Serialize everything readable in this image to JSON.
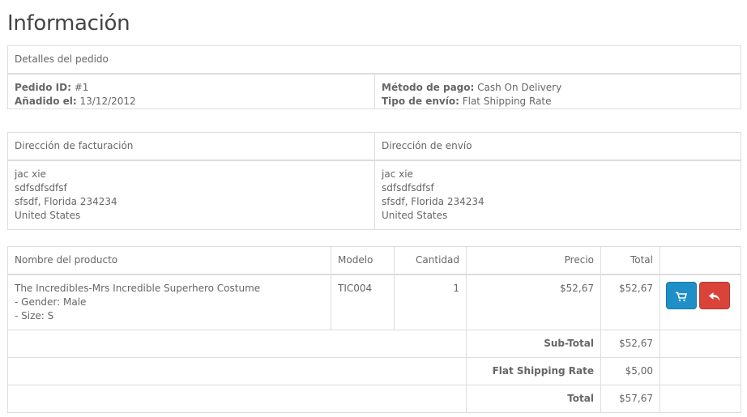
{
  "page_title": "Información",
  "order": {
    "header": "Detalles del pedido",
    "order_id_label": "Pedido ID:",
    "order_id_value": "#1",
    "date_label": "Añadido el:",
    "date_value": "13/12/2012",
    "payment_label": "Método de pago:",
    "payment_value": "Cash On Delivery",
    "shipping_label": "Tipo de envío:",
    "shipping_value": "Flat Shipping Rate"
  },
  "addresses": {
    "billing_header": "Dirección de facturación",
    "shipping_header": "Dirección de envío",
    "billing_lines": [
      "jac xie",
      "sdfsdfsdfsf",
      "sfsdf, Florida 234234",
      "United States"
    ],
    "shipping_lines": [
      "jac xie",
      "sdfsdfsdfsf",
      "sfsdf, Florida 234234",
      "United States"
    ]
  },
  "products": {
    "headers": {
      "name": "Nombre del producto",
      "model": "Modelo",
      "quantity": "Cantidad",
      "price": "Precio",
      "total": "Total"
    },
    "rows": [
      {
        "name": "The Incredibles-Mrs Incredible Superhero Costume",
        "options": [
          "- Gender: Male",
          "- Size: S"
        ],
        "model": "TIC004",
        "quantity": "1",
        "price": "$52,67",
        "total": "$52,67",
        "reorder_icon": "cart-icon",
        "return_icon": "reply-icon"
      }
    ],
    "totals": [
      {
        "label": "Sub-Total",
        "value": "$52,67"
      },
      {
        "label": "Flat Shipping Rate",
        "value": "$5,00"
      },
      {
        "label": "Total",
        "value": "$57,67"
      }
    ]
  },
  "colors": {
    "reorder_button": "#1f8fc7",
    "return_button": "#d9433a",
    "border": "#dddddd"
  }
}
